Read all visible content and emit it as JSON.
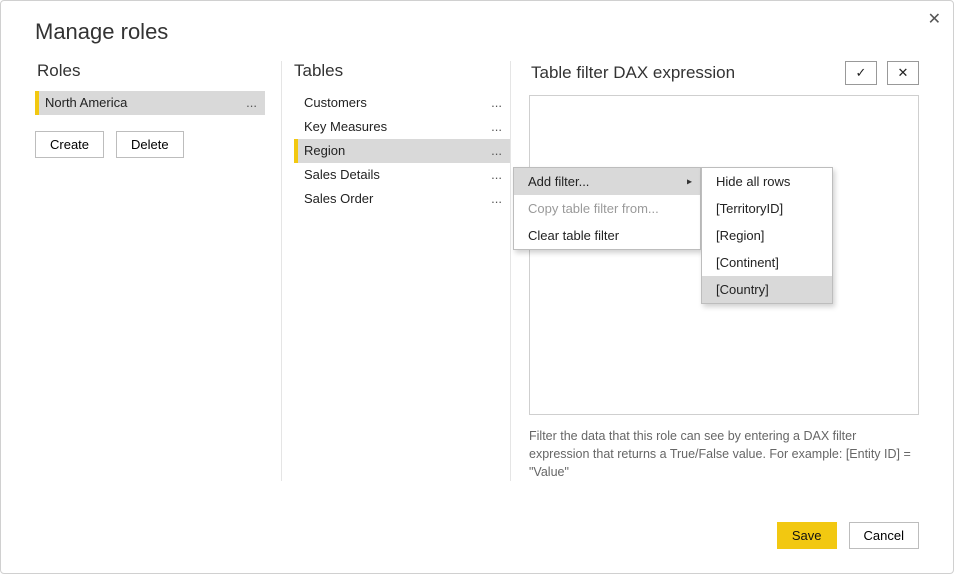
{
  "dialog": {
    "title": "Manage roles"
  },
  "roles": {
    "header": "Roles",
    "items": [
      {
        "label": "North America",
        "selected": true
      }
    ],
    "buttons": {
      "create": "Create",
      "delete": "Delete"
    }
  },
  "tables": {
    "header": "Tables",
    "items": [
      {
        "label": "Customers",
        "selected": false
      },
      {
        "label": "Key Measures",
        "selected": false
      },
      {
        "label": "Region",
        "selected": true
      },
      {
        "label": "Sales Details",
        "selected": false
      },
      {
        "label": "Sales Order",
        "selected": false
      }
    ]
  },
  "dax": {
    "header": "Table filter DAX expression",
    "accept_tooltip": "Accept",
    "cancel_tooltip": "Cancel",
    "hint": "Filter the data that this role can see by entering a DAX filter expression that returns a True/False value. For example: [Entity ID] = \"Value\""
  },
  "context_menu": {
    "items": [
      {
        "label": "Add filter...",
        "has_submenu": true,
        "hover": true,
        "disabled": false
      },
      {
        "label": "Copy table filter from...",
        "has_submenu": false,
        "hover": false,
        "disabled": true
      },
      {
        "label": "Clear table filter",
        "has_submenu": false,
        "hover": false,
        "disabled": false
      }
    ],
    "submenu": [
      {
        "label": "Hide all rows",
        "hover": false
      },
      {
        "label": "[TerritoryID]",
        "hover": false
      },
      {
        "label": "[Region]",
        "hover": false
      },
      {
        "label": "[Continent]",
        "hover": false
      },
      {
        "label": "[Country]",
        "hover": true
      }
    ]
  },
  "footer": {
    "save": "Save",
    "cancel": "Cancel"
  },
  "glyphs": {
    "ellipsis": "...",
    "check": "✓",
    "cross": "✕",
    "chevron_right": "▸",
    "close": "✕"
  }
}
